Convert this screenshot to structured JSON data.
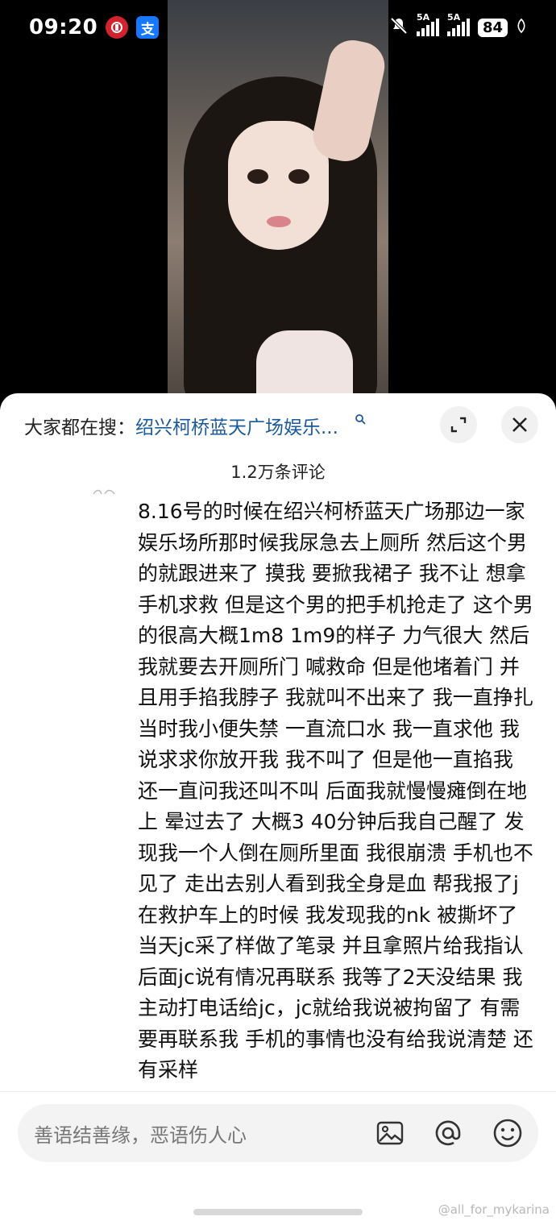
{
  "status_bar": {
    "time": "09:20",
    "app_icons": [
      "bank-app-icon",
      "alipay-icon"
    ],
    "alipay_glyph": "支",
    "network_1": "5A",
    "network_2": "5A",
    "battery": "84"
  },
  "sheet": {
    "search_prefix": "大家都在搜：",
    "search_link": "绍兴柯桥蓝天广场娱乐...",
    "comment_count": "1.2万条评论",
    "comment_body": "8.16号的时候在绍兴柯桥蓝天广场那边一家娱乐场所那时候我尿急去上厕所 然后这个男的就跟进来了 摸我 要掀我裙子 我不让 想拿手机求救 但是这个男的把手机抢走了 这个男的很高大概1m8 1m9的样子 力气很大 然后我就要去开厕所门 喊救命 但是他堵着门 并且用手掐我脖子 我就叫不出来了 我一直挣扎 当时我小便失禁 一直流口水 我一直求他 我说求求你放开我 我不叫了 但是他一直掐我 还一直问我还叫不叫 后面我就慢慢瘫倒在地上 晕过去了 大概3 40分钟后我自己醒了 发现我一个人倒在厕所里面 我很崩溃 手机也不见了 走出去别人看到我全身是血 帮我报了j 在救护车上的时候 我发现我的nk 被撕坏了 当天jc采了样做了笔录 并且拿照片给我指认 后面jc说有情况再联系 我等了2天没结果 我主动打电话给jc，jc就给我说被拘留了 有需要再联系我 手机的事情也没有给我说清楚 还有采样"
  },
  "input_bar": {
    "placeholder": "善语结善缘，恶语伤人心"
  },
  "watermark": "@all_for_mykarina",
  "colors": {
    "link": "#1a5a9c",
    "sheet_bg": "#ffffff",
    "input_bg": "#f3f3f3"
  }
}
